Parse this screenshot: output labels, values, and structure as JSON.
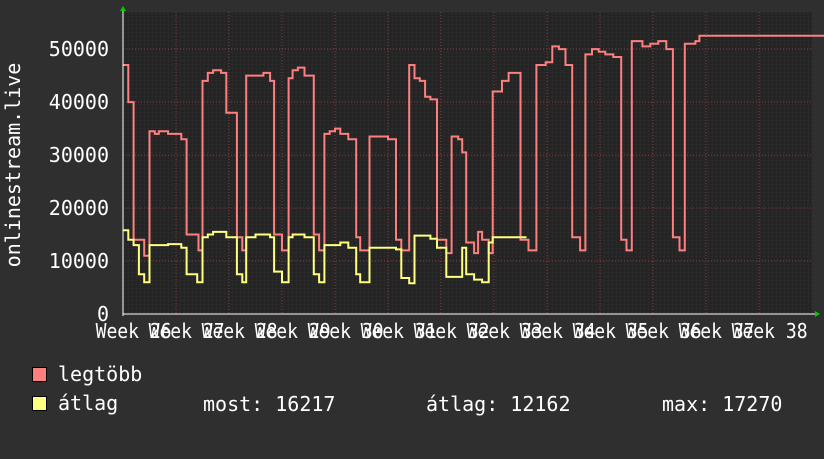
{
  "chart_data": {
    "type": "line",
    "ylabel": "onlinestream.live",
    "yticks": [
      0,
      10000,
      20000,
      30000,
      40000,
      50000
    ],
    "ylim": [
      0,
      57000
    ],
    "xticks": [
      "Week 26",
      "Week 27",
      "Week 28",
      "Week 29",
      "Week 30",
      "Week 31",
      "Week 32",
      "Week 33",
      "Week 34",
      "Week 35",
      "Week 36",
      "Week 37",
      "Week 38"
    ],
    "grid": true,
    "series": [
      {
        "name": "legtöbb",
        "color": "#ff7f7f",
        "x": [
          0,
          0.2,
          0.4,
          0.8,
          1.0,
          1.2,
          1.35,
          1.7,
          2.2,
          2.4,
          2.85,
          3.0,
          3.2,
          3.4,
          3.7,
          3.9,
          4.3,
          4.5,
          4.65,
          5.0,
          5.3,
          5.55,
          5.7,
          6.0,
          6.25,
          6.4,
          6.6,
          6.85,
          7.2,
          7.4,
          7.6,
          7.8,
          8.0,
          8.2,
          8.5,
          8.8,
          8.95,
          9.3,
          9.55,
          9.75,
          10.0,
          10.3,
          10.5,
          10.8,
          11.0,
          11.2,
          11.4,
          11.6,
          11.85,
          12.2,
          12.4,
          12.65,
          12.8,
          12.95,
          13.25,
          13.4,
          13.55,
          13.8,
          13.95,
          14.3,
          14.55,
          14.8,
          15.0,
          15.3,
          15.6,
          15.95,
          16.2,
          16.45,
          16.7,
          16.95,
          17.25,
          17.45,
          17.7,
          17.95,
          18.2,
          18.5,
          18.8,
          19.0,
          19.2,
          19.6,
          19.9,
          20.2,
          20.5,
          20.75,
          21.0,
          21.2,
          21.6,
          21.75,
          21.95,
          22.2,
          22.35,
          22.6,
          22.8,
          22.95,
          23.2,
          23.5,
          23.7,
          23.9,
          24.2,
          24.4,
          24.6,
          24.8,
          25.0,
          25.3,
          25.5,
          25.75,
          26.0,
          26.25
        ],
        "y": [
          47000,
          40000,
          14000,
          11000,
          34500,
          34000,
          34500,
          34000,
          33000,
          15000,
          12000,
          44000,
          45500,
          46000,
          45500,
          38000,
          14500,
          12000,
          45000,
          45000,
          45500,
          44000,
          15000,
          12000,
          44500,
          46000,
          46500,
          45000,
          15000,
          12000,
          34000,
          34500,
          35000,
          34000,
          33000,
          14500,
          12000,
          33500,
          33500,
          33500,
          33000,
          14000,
          12000,
          47000,
          44500,
          44000,
          41000,
          40500,
          14000,
          11500,
          33500,
          33000,
          30500,
          13500,
          11500,
          15500,
          14000,
          11500,
          42000,
          44000,
          45500,
          45500,
          14000,
          12000,
          47000,
          47500,
          50500,
          50000,
          47000,
          14500,
          12000,
          49000,
          50000,
          49500,
          49000,
          48500,
          14000,
          12000,
          51500,
          50500,
          51000,
          51500,
          50000,
          14500,
          12000,
          51000,
          51500,
          52500,
          52500,
          52500,
          52500,
          52500,
          52500,
          52500,
          52500,
          52500,
          52500,
          52500,
          52500,
          52500,
          52500,
          52500,
          52500,
          52500,
          52500,
          52500,
          52500,
          52500
        ]
      },
      {
        "name": "átlag",
        "color": "#ffff80",
        "x": [
          0,
          0.2,
          0.4,
          0.6,
          0.8,
          1.0,
          1.2,
          1.7,
          2.2,
          2.4,
          2.8,
          3.0,
          3.2,
          3.4,
          3.9,
          4.3,
          4.5,
          4.65,
          5.0,
          5.55,
          5.7,
          6.0,
          6.25,
          6.4,
          6.85,
          7.2,
          7.4,
          7.6,
          8.2,
          8.5,
          8.8,
          8.95,
          9.3,
          10.3,
          10.5,
          10.8,
          11.0,
          11.6,
          11.85,
          12.2,
          12.8,
          12.95,
          13.25,
          13.55,
          13.8,
          13.95,
          14.3,
          15.0
        ],
        "y": [
          15800,
          14000,
          13000,
          7500,
          6000,
          13000,
          13000,
          13200,
          12500,
          7500,
          6000,
          14500,
          15000,
          15500,
          14500,
          7500,
          6000,
          14500,
          15000,
          14500,
          8000,
          6000,
          14500,
          15000,
          14500,
          7500,
          6000,
          13000,
          13500,
          12500,
          7500,
          6000,
          12500,
          12200,
          6800,
          5800,
          14800,
          14200,
          12500,
          7000,
          12500,
          7500,
          6500,
          6000,
          13500,
          14500,
          14500,
          14500
        ]
      }
    ]
  },
  "legend": [
    {
      "label": "legtöbb",
      "color": "#ff7f7f"
    },
    {
      "label": "átlag",
      "color": "#ffff80"
    }
  ],
  "stats": {
    "most": "most: 16217",
    "atlag": "átlag: 12162",
    "max": "max: 17270"
  },
  "colors": {
    "background": "#2f2f2f",
    "plot": "#242424",
    "grid": "#4a4a4a",
    "axis": "#ffffff",
    "arrow": "#00cc00"
  }
}
